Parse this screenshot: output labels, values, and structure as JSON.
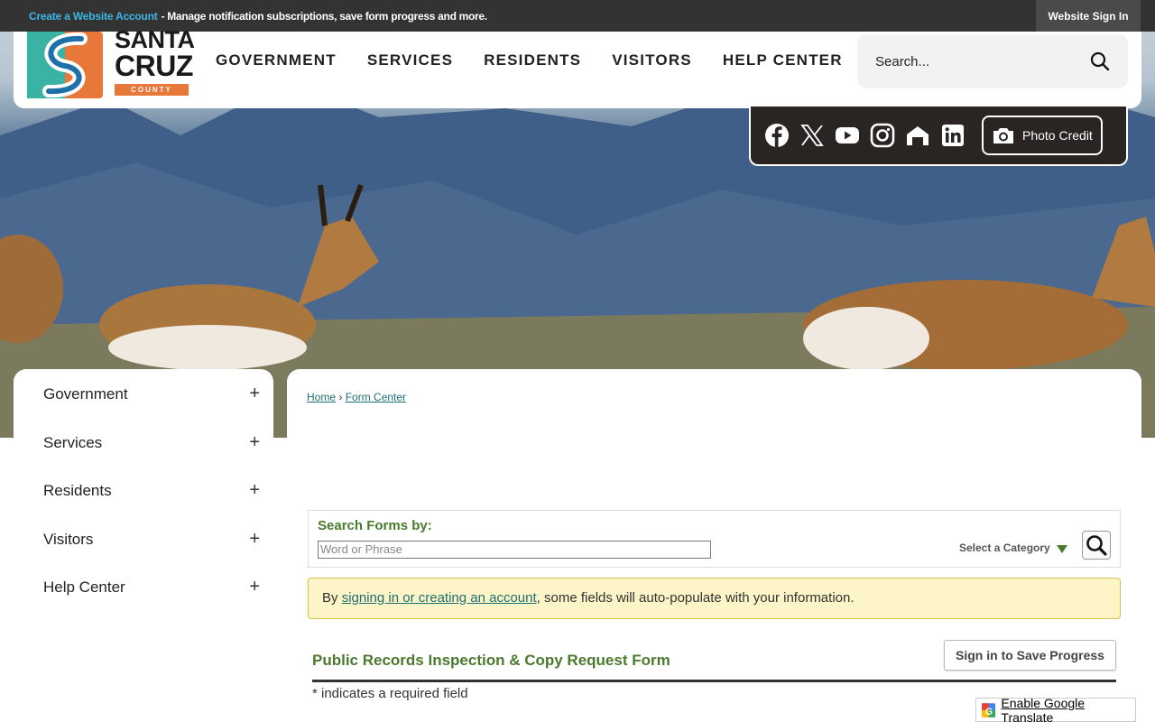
{
  "topbar": {
    "create_account": "Create a Website Account",
    "manage_text": "- Manage notification subscriptions, save form progress and more.",
    "sign_in": "Website Sign In"
  },
  "logo": {
    "line1": "SANTA",
    "line2": "CRUZ",
    "line3": "COUNTY"
  },
  "nav": {
    "items": [
      "GOVERNMENT",
      "SERVICES",
      "RESIDENTS",
      "VISITORS",
      "HELP CENTER"
    ]
  },
  "search": {
    "placeholder": "Search..."
  },
  "social": {
    "icons": [
      "facebook-icon",
      "x-twitter-icon",
      "youtube-icon",
      "instagram-icon",
      "nextdoor-icon",
      "linkedin-icon"
    ],
    "photo_credit": "Photo Credit"
  },
  "sidebar": {
    "items": [
      {
        "label": "Government"
      },
      {
        "label": "Services"
      },
      {
        "label": "Residents"
      },
      {
        "label": "Visitors"
      },
      {
        "label": "Help Center"
      }
    ],
    "expand_symbol": "+"
  },
  "breadcrumb": {
    "home": "Home",
    "separator": "›",
    "current": "Form Center"
  },
  "form_search": {
    "label": "Search Forms by:",
    "placeholder": "Word or Phrase",
    "category": "Select a Category"
  },
  "notice": {
    "prefix": "By ",
    "link": "signing in or creating an account",
    "suffix": ", some fields will auto-populate with your information."
  },
  "form": {
    "title": "Public Records Inspection & Copy Request Form",
    "save_button": "Sign in to Save Progress",
    "required_note": "* indicates a required field"
  },
  "translate": {
    "label": "Enable Google Translate"
  },
  "colors": {
    "topbar": "#333333",
    "link_teal": "#1f6f72",
    "green_heading": "#4a7a2e",
    "notice_bg": "#fdf5c7",
    "logo_orange": "#e8783a"
  }
}
